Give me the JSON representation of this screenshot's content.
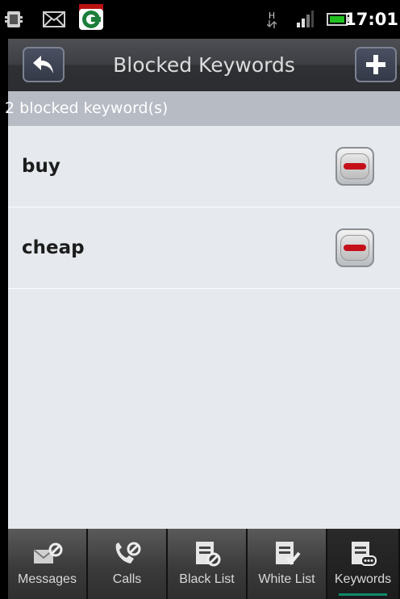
{
  "status_bar": {
    "time": "17:01",
    "network": "H",
    "icons": [
      "sd-card-icon",
      "mail-icon",
      "app-notification-icon",
      "network-icon",
      "signal-icon",
      "battery-icon"
    ]
  },
  "title_bar": {
    "title": "Blocked Keywords",
    "back_icon": "back-arrow-icon",
    "add_icon": "plus-icon"
  },
  "summary": "2 blocked keyword(s)",
  "keywords": [
    {
      "label": "buy",
      "delete_icon": "minus-icon"
    },
    {
      "label": "cheap",
      "delete_icon": "minus-icon"
    }
  ],
  "tabs": [
    {
      "label": "Messages",
      "icon": "message-block-icon",
      "active": false
    },
    {
      "label": "Calls",
      "icon": "call-block-icon",
      "active": false
    },
    {
      "label": "Black List",
      "icon": "black-list-icon",
      "active": false
    },
    {
      "label": "White List",
      "icon": "white-list-icon",
      "active": false
    },
    {
      "label": "Keywords",
      "icon": "keywords-icon",
      "active": true
    }
  ],
  "colors": {
    "delete_red": "#c5101a",
    "active_tab_underline": "#0e8b6a",
    "list_background": "#e6eaee",
    "summary_bar": "#b6bbc4"
  }
}
